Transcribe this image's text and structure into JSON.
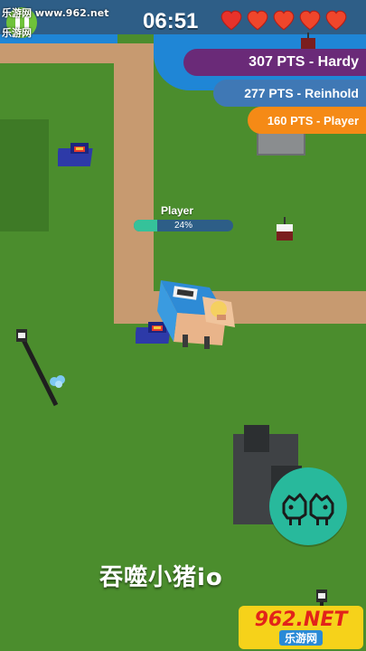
{
  "watermark": {
    "top": "乐游网 www.962.net",
    "left": "乐游网"
  },
  "hud": {
    "timer": "06:51",
    "lives": 5,
    "pause_icon": "pause-icon",
    "heart_icon": "heart-icon"
  },
  "leaderboard": [
    {
      "label": "307 PTS - Hardy",
      "color": "#6a2a78"
    },
    {
      "label": "277 PTS - Reinhold",
      "color": "#3f78b5"
    },
    {
      "label": "160 PTS - Player",
      "color": "#f58a16"
    }
  ],
  "player": {
    "name": "Player",
    "progress_label": "24%",
    "progress": 0.24
  },
  "ability_button": {
    "icon": "twin-pigs-icon"
  },
  "caption": "吞噬小猪io",
  "logo": {
    "main": "962.NET",
    "sub": "乐游网"
  }
}
